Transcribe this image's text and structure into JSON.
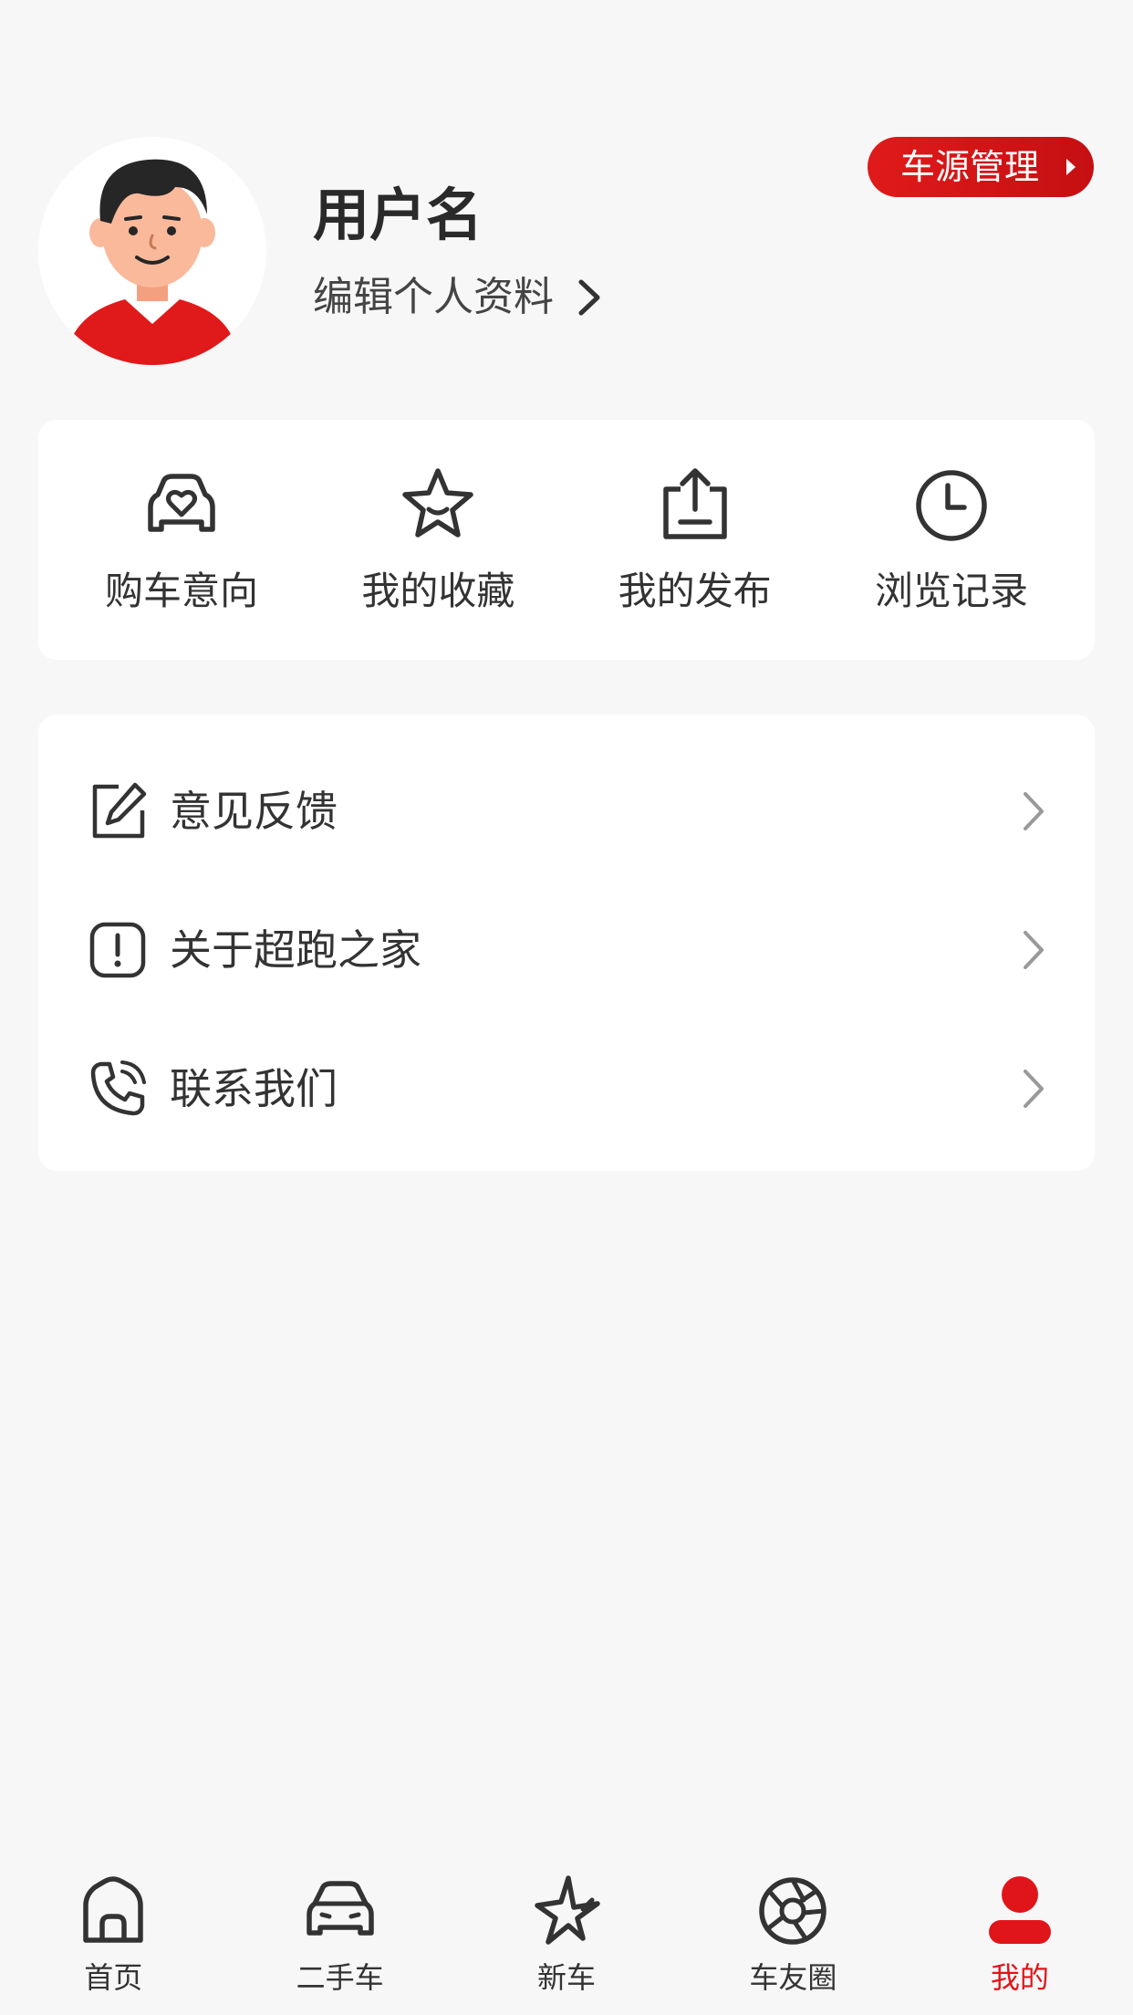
{
  "profile": {
    "username": "用户名",
    "edit_profile_label": "编辑个人资料",
    "manage_button_label": "车源管理"
  },
  "quick_actions": [
    {
      "label": "购车意向",
      "icon": "car-heart-icon"
    },
    {
      "label": "我的收藏",
      "icon": "star-icon"
    },
    {
      "label": "我的发布",
      "icon": "upload-icon"
    },
    {
      "label": "浏览记录",
      "icon": "clock-icon"
    }
  ],
  "menu": [
    {
      "label": "意见反馈",
      "icon": "edit-feedback-icon"
    },
    {
      "label": "关于超跑之家",
      "icon": "info-exclamation-icon"
    },
    {
      "label": "联系我们",
      "icon": "phone-icon"
    }
  ],
  "bottom_nav": [
    {
      "label": "首页",
      "icon": "home-icon",
      "active": false
    },
    {
      "label": "二手车",
      "icon": "car-icon",
      "active": false
    },
    {
      "label": "新车",
      "icon": "spark-icon",
      "active": false
    },
    {
      "label": "车友圈",
      "icon": "aperture-icon",
      "active": false
    },
    {
      "label": "我的",
      "icon": "user-icon",
      "active": true
    }
  ],
  "colors": {
    "accent": "#e0151a",
    "background": "#f7f7f8",
    "card": "#ffffff",
    "text": "#333333"
  }
}
